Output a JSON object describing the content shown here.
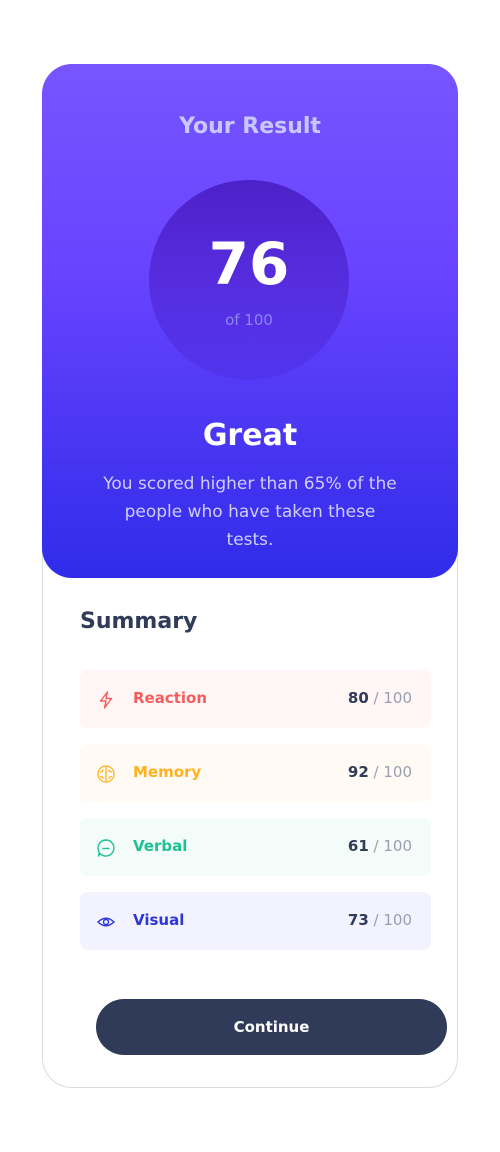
{
  "result": {
    "title": "Your Result",
    "score": "76",
    "score_of": "of 100",
    "rating": "Great",
    "description": "You scored higher than 65% of the people who have taken these tests."
  },
  "summary": {
    "title": "Summary",
    "items": [
      {
        "label": "Reaction",
        "score": "80",
        "total": " / 100",
        "icon": "lightning-icon",
        "color": "#f55d5d",
        "bg": "#fff6f5"
      },
      {
        "label": "Memory",
        "score": "92",
        "total": " / 100",
        "icon": "brain-icon",
        "color": "#ffb21e",
        "bg": "#fffbf4"
      },
      {
        "label": "Verbal",
        "score": "61",
        "total": " / 100",
        "icon": "chat-icon",
        "color": "#1dc192",
        "bg": "#f3fcf9"
      },
      {
        "label": "Visual",
        "score": "73",
        "total": " / 100",
        "icon": "eye-icon",
        "color": "#2f36d6",
        "bg": "#f2f3fe"
      }
    ]
  },
  "actions": {
    "continue_label": "Continue"
  },
  "colors": {
    "gradient_top": "#7755ff",
    "gradient_bottom": "#2f2ce9",
    "button": "#303b5a"
  }
}
